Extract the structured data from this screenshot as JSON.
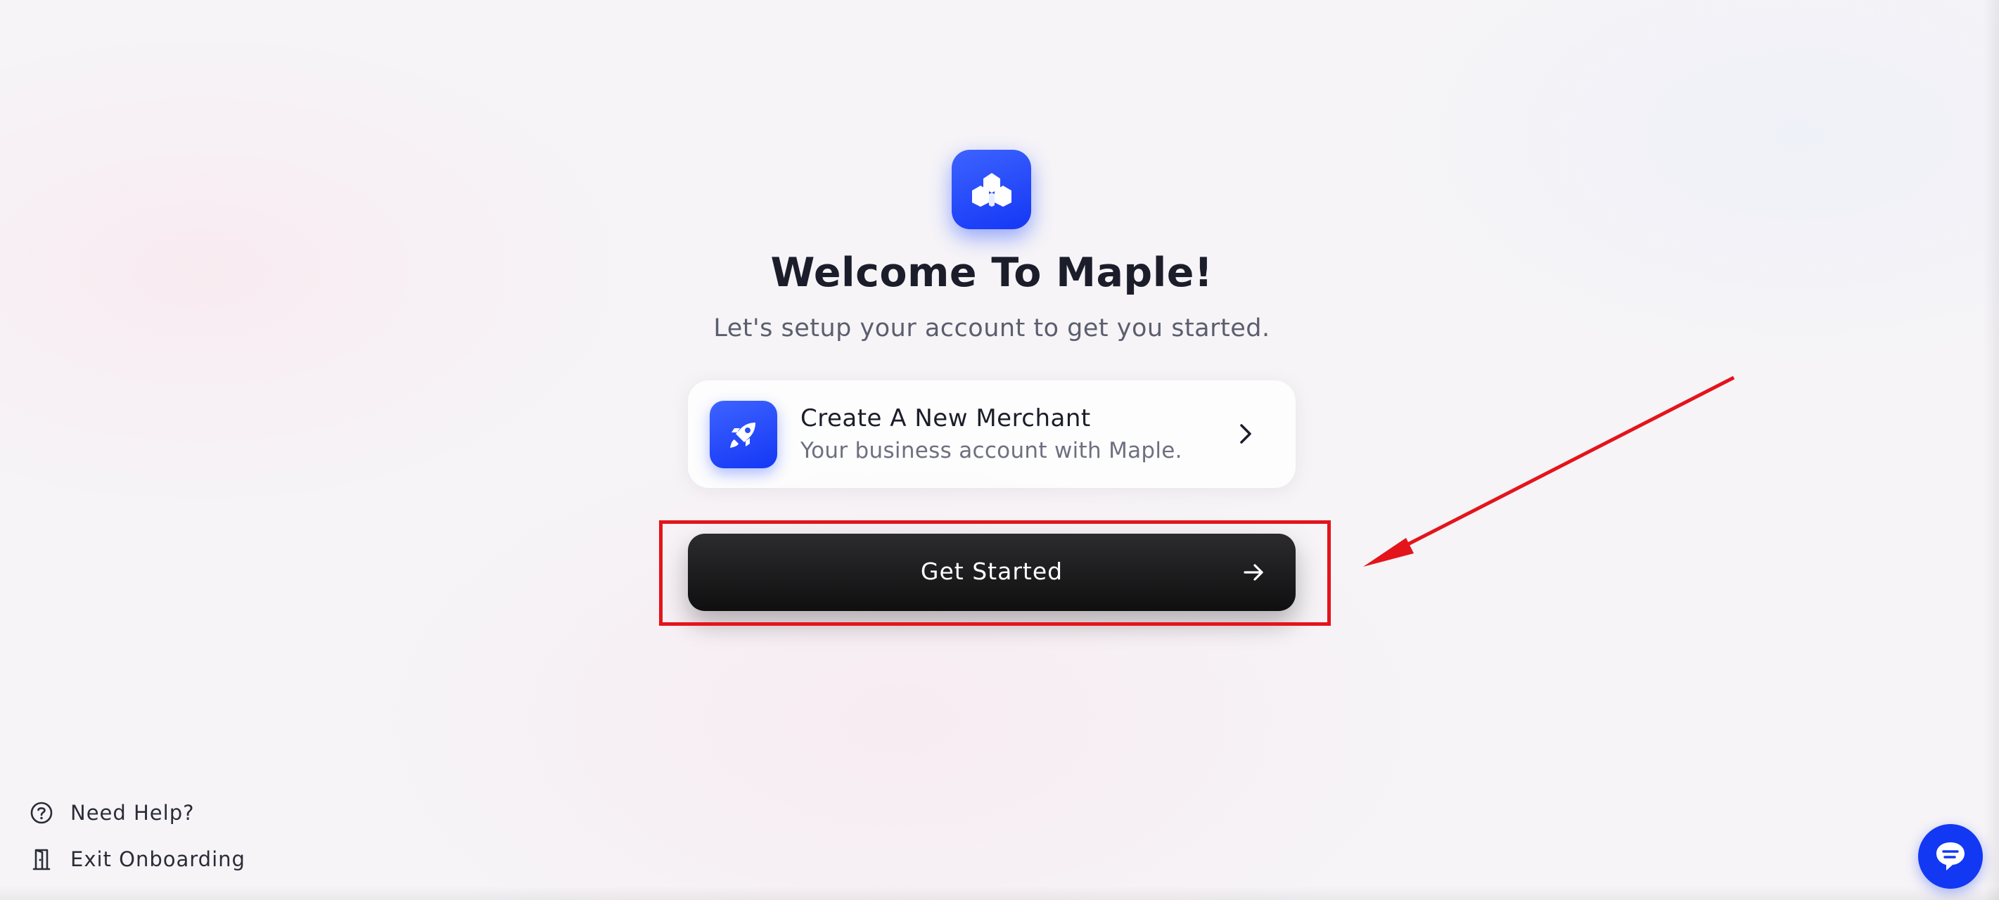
{
  "app": {
    "logo_icon": "maple-leaf-cubes-icon",
    "accent_color": "#1c3ff6"
  },
  "header": {
    "title": "Welcome To Maple!",
    "subtitle": "Let's setup your account to get you started."
  },
  "merchant_option": {
    "icon": "rocket-icon",
    "title": "Create A New Merchant",
    "description": "Your business account with Maple.",
    "chevron_icon": "chevron-right-icon"
  },
  "primary_action": {
    "label": "Get Started",
    "icon": "arrow-right-icon"
  },
  "annotation": {
    "highlight_color": "#e4141b",
    "pointer": "red-arrow"
  },
  "footer": {
    "links": [
      {
        "label": "Need Help?",
        "icon": "question-circle-icon"
      },
      {
        "label": "Exit Onboarding",
        "icon": "door-exit-icon"
      }
    ]
  },
  "chat": {
    "icon": "chat-bubble-icon"
  }
}
